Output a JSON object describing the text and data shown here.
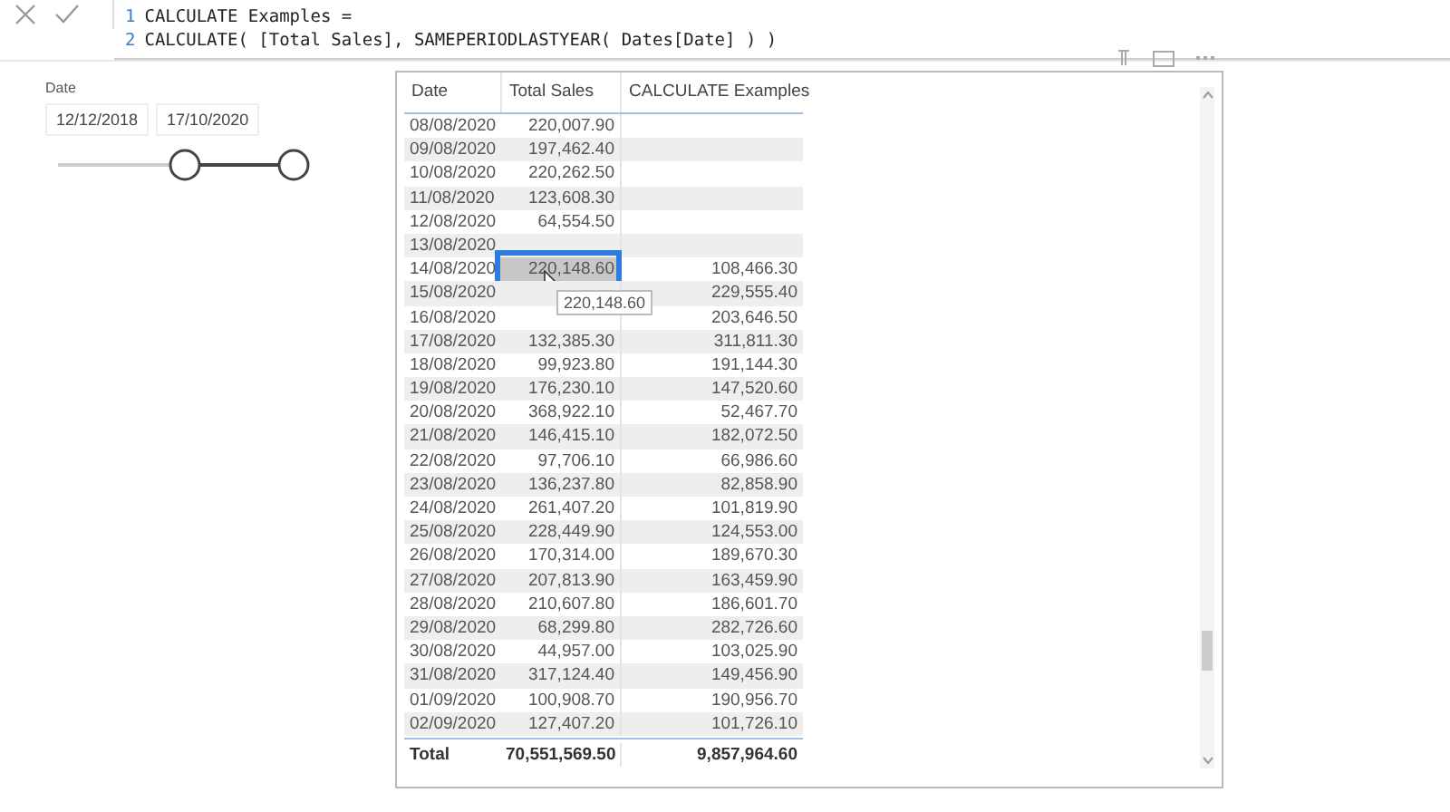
{
  "formula_bar": {
    "lines": [
      {
        "number": "1",
        "code": "CALCULATE Examples ="
      },
      {
        "number": "2",
        "code": "CALCULATE( [Total Sales], SAMEPERIODLASTYEAR( Dates[Date] ) )"
      }
    ]
  },
  "slicer": {
    "title": "Date",
    "start": "12/12/2018",
    "end": "17/10/2020"
  },
  "table": {
    "columns": [
      "Date",
      "Total Sales",
      "CALCULATE Examples"
    ],
    "rows": [
      {
        "date": "08/08/2020",
        "total_sales": "220,007.90",
        "selected": false
      },
      {
        "date": "09/08/2020",
        "total_sales": "197,462.40",
        "selected": false
      },
      {
        "date": "10/08/2020",
        "total_sales": "220,262.50",
        "selected": false
      },
      {
        "date": "11/08/2020",
        "total_sales": "123,608.30",
        "selected": false
      },
      {
        "date": "12/08/2020",
        "total_sales": "64,554.50",
        "selected": false
      },
      {
        "date": "13/08/2020",
        "selected": false
      },
      {
        "date": "14/08/2020",
        "total_sales": "220,148.60",
        "calculate": "108,466.30",
        "selected": true
      },
      {
        "date": "15/08/2020",
        "calculate": "229,555.40",
        "selected": false
      },
      {
        "date": "16/08/2020",
        "calculate": "203,646.50",
        "selected": false
      },
      {
        "date": "17/08/2020",
        "total_sales": "132,385.30",
        "calculate": "311,811.30",
        "selected": false
      },
      {
        "date": "18/08/2020",
        "total_sales": "99,923.80",
        "calculate": "191,144.30",
        "selected": false
      },
      {
        "date": "19/08/2020",
        "total_sales": "176,230.10",
        "calculate": "147,520.60",
        "selected": false
      },
      {
        "date": "20/08/2020",
        "total_sales": "368,922.10",
        "calculate": "52,467.70",
        "selected": false
      },
      {
        "date": "21/08/2020",
        "total_sales": "146,415.10",
        "calculate": "182,072.50",
        "selected": false
      },
      {
        "date": "22/08/2020",
        "total_sales": "97,706.10",
        "calculate": "66,986.60",
        "selected": false
      },
      {
        "date": "23/08/2020",
        "total_sales": "136,237.80",
        "calculate": "82,858.90",
        "selected": false
      },
      {
        "date": "24/08/2020",
        "total_sales": "261,407.20",
        "calculate": "101,819.90",
        "selected": false
      },
      {
        "date": "25/08/2020",
        "total_sales": "228,449.90",
        "calculate": "124,553.00",
        "selected": false
      },
      {
        "date": "26/08/2020",
        "total_sales": "170,314.00",
        "calculate": "189,670.30",
        "selected": false
      },
      {
        "date": "27/08/2020",
        "total_sales": "207,813.90",
        "calculate": "163,459.90",
        "selected": false
      },
      {
        "date": "28/08/2020",
        "total_sales": "210,607.80",
        "calculate": "186,601.70",
        "selected": false
      },
      {
        "date": "29/08/2020",
        "total_sales": "68,299.80",
        "calculate": "282,726.60",
        "selected": false
      },
      {
        "date": "30/08/2020",
        "total_sales": "44,957.00",
        "calculate": "103,025.90",
        "selected": false
      },
      {
        "date": "31/08/2020",
        "total_sales": "317,124.40",
        "calculate": "149,456.90",
        "selected": false
      },
      {
        "date": "01/09/2020",
        "total_sales": "100,908.70",
        "calculate": "190,956.70",
        "selected": false
      },
      {
        "date": "02/09/2020",
        "total_sales": "127,407.20",
        "calculate": "101,726.10",
        "selected": false
      }
    ],
    "total": {
      "label": "Total",
      "total_sales": "70,551,569.50",
      "calculate": "9,857,964.60"
    },
    "tooltip": "220,148.60"
  }
}
